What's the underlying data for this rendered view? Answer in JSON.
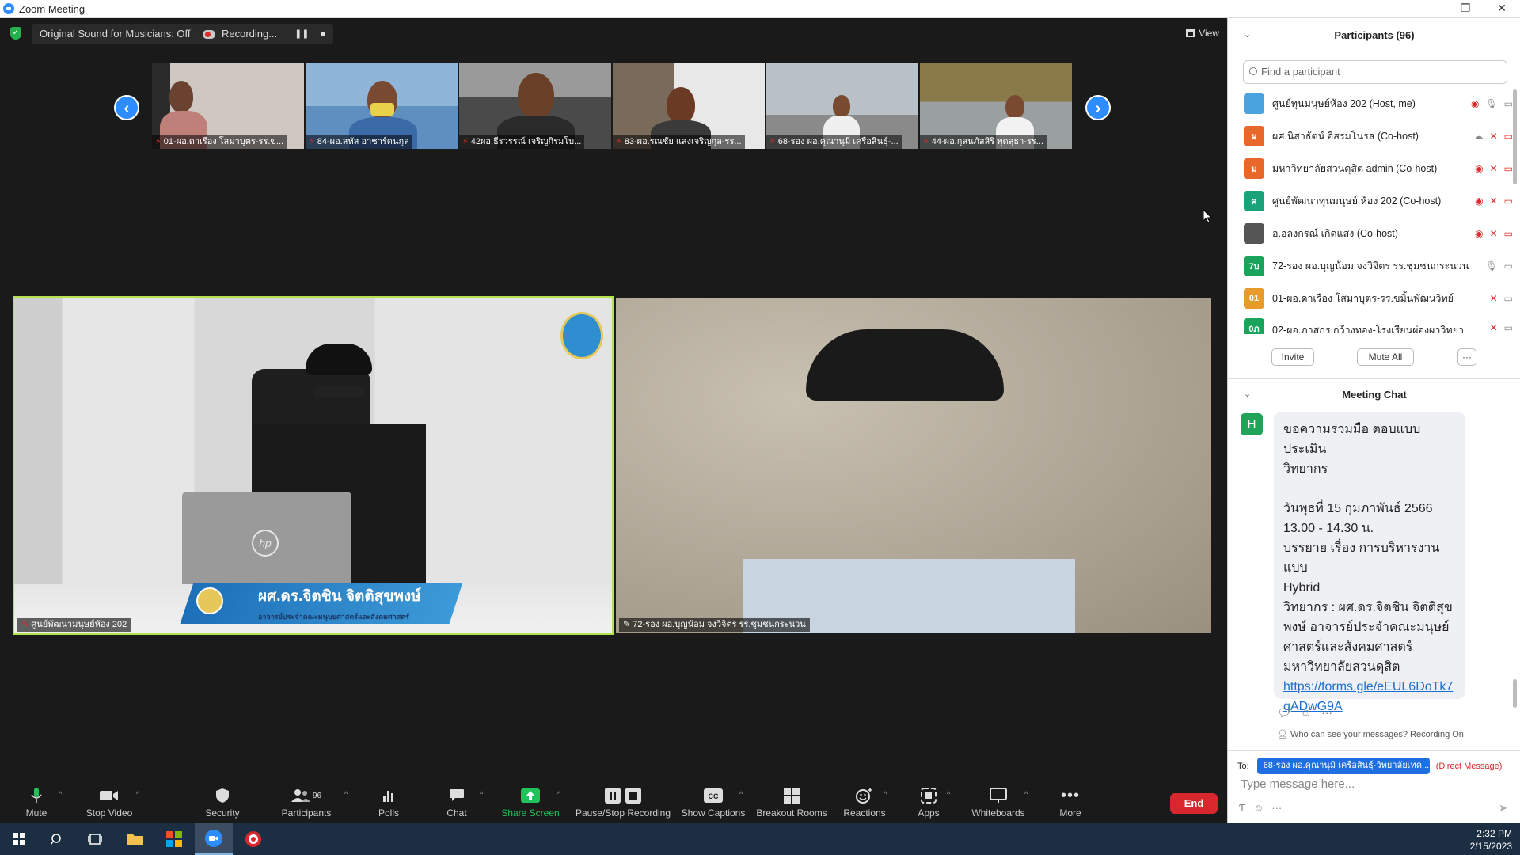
{
  "window": {
    "title": "Zoom Meeting",
    "controls": [
      "—",
      "❐",
      "✕"
    ]
  },
  "topbar": {
    "original_sound": "Original Sound for Musicians: Off",
    "recording": "Recording...",
    "view": "View"
  },
  "thumbnails": [
    {
      "name": "01-ผอ.ดาเรือง โสมาบุตร-รร.ข..."
    },
    {
      "name": "84-ผอ.สหัส อาชาร์ดนกุล"
    },
    {
      "name": "42ผอ.ธีรวรรณ์ เจริญกิรมโบ..."
    },
    {
      "name": "83-ผอ.รณชัย แสงเจริญกุล-รร..."
    },
    {
      "name": "68-รอง ผอ.คุณานุมิ เครือสินธุ์-..."
    },
    {
      "name": "44-ผอ.กุลนภัสสิริ พุดสุธา-รร..."
    }
  ],
  "videos": {
    "speaker": {
      "label": "ศูนย์พัฒนามนุษย์ห้อง 202",
      "banner_name": "ผศ.ดร.จิตชิน จิตติสุขพงษ์",
      "banner_sub": "อาจารย์ประจำคณะมนุษยศาสตร์และสังคมศาสตร์",
      "laptop_logo": "hp"
    },
    "second": {
      "label": "72-รอง ผอ.บุญน้อม จงวิจิตร รร.ชุมชนกระนวน"
    }
  },
  "toolbar": {
    "mute": "Mute",
    "stop_video": "Stop Video",
    "security": "Security",
    "participants": "Participants",
    "participants_count": "96",
    "polls": "Polls",
    "chat": "Chat",
    "share_screen": "Share Screen",
    "pause_recording": "Pause/Stop Recording",
    "captions": "Show Captions",
    "breakout": "Breakout Rooms",
    "reactions": "Reactions",
    "apps": "Apps",
    "whiteboards": "Whiteboards",
    "more": "More",
    "end": "End"
  },
  "participants_panel": {
    "title": "Participants (96)",
    "search_placeholder": "Find a participant",
    "rows": [
      {
        "avatar": "",
        "avatar_color": "#4aa3df",
        "name": "ศูนย์ทุนมนุษย์ห้อง 202 (Host, me)"
      },
      {
        "avatar": "ผ",
        "avatar_color": "#e8672a",
        "name": "ผศ.นิสาธัตน์ อิสรมโนรส (Co-host)"
      },
      {
        "avatar": "ม",
        "avatar_color": "#e8672a",
        "name": "มหาวิทยาลัยสวนดุสิต admin (Co-host)"
      },
      {
        "avatar": "ศ",
        "avatar_color": "#1aa37a",
        "name": "ศูนย์พัฒนาทุนมนุษย์ ห้อง 202 (Co-host)"
      },
      {
        "avatar": "",
        "avatar_color": "#555555",
        "name": "อ.อลงกรณ์ เกิดแสง (Co-host)"
      },
      {
        "avatar": "7บ",
        "avatar_color": "#1aa35a",
        "name": "72-รอง ผอ.บุญน้อม จงวิจิตร รร.ชุมชนกระนวน"
      },
      {
        "avatar": "01",
        "avatar_color": "#e89a2a",
        "name": "01-ผอ.ดาเรือง โสมาบุตร-รร.ขมิ้นพัฒนวิทย์"
      },
      {
        "avatar": "0ภ",
        "avatar_color": "#1aa35a",
        "name": "02-ผอ.ภาสกร กว้างทอง-โรงเรียนผ่องผาวิทยา"
      }
    ],
    "invite": "Invite",
    "mute_all": "Mute All",
    "more": "···"
  },
  "chat_panel": {
    "title": "Meeting Chat",
    "sender_initial": "H",
    "message_lines": [
      "ขอความร่วมมือ ตอบแบบประเมิน",
      "วิทยากร",
      "",
      "วันพุธที่ 15 กุมภาพันธ์ 2566",
      "13.00 - 14.30 น.",
      "บรรยาย เรื่อง  การบริหารงานแบบ",
      "Hybrid",
      "วิทยากร : ผศ.ดร.จิตชิน จิตติสุข",
      "พงษ์  อาจารย์ประจำคณะมนุษย์",
      "ศาสตร์และสังคมศาสตร์",
      "มหาวิทยาลัยสวนดุสิต"
    ],
    "link": "https://forms.gle/eEUL6DoTk7qADwG9A",
    "who_can_see": "Who can see your messages? Recording On",
    "to_label": "To:",
    "to_value": "68-รอง ผอ.คุณานุมิ เครือสินธุ์-วิทยาลัยเทค...",
    "direct_message": "(Direct Message)",
    "input_placeholder": "Type message here..."
  },
  "taskbar": {
    "time": "2:32 PM",
    "date": "2/15/2023"
  }
}
